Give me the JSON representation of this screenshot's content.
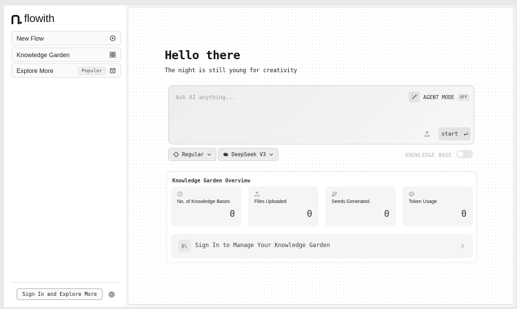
{
  "app": {
    "name": "flowith"
  },
  "sidebar": {
    "items": [
      {
        "label": "New Flow",
        "icon": "chat-plus-icon"
      },
      {
        "label": "Knowledge Garden",
        "icon": "grid-icon"
      },
      {
        "label": "Explore More",
        "badge": "Popular",
        "icon": "store-icon"
      }
    ],
    "signin_label": "Sign In and Explore More",
    "settings_icon": "gear-icon"
  },
  "main": {
    "greeting": "Hello there",
    "tagline": "The night is still young for creativity",
    "prompt": {
      "placeholder": "Ask AI anything...",
      "agent_mode_label": "AGENT MODE",
      "agent_mode_state": "OFF",
      "start_label": "start"
    },
    "mode_chip": "Regular",
    "model_chip": "DeepSeek V3",
    "knowledge_base_label": "KNOWLEDGE BASE",
    "knowledge_base_enabled": false,
    "knowledge_garden": {
      "title": "Knowledge Garden Overview",
      "stats": [
        {
          "label": "No. of Knowledge Bases",
          "value": "0",
          "icon": "clock-icon"
        },
        {
          "label": "Files Uploaded",
          "value": "0",
          "icon": "upload-icon"
        },
        {
          "label": "Seeds Generated",
          "value": "0",
          "icon": "leaf-icon"
        },
        {
          "label": "Token Usage",
          "value": "0",
          "icon": "token-icon"
        }
      ],
      "signin_cta": "Sign In to Manage Your Knowledge Garden"
    }
  },
  "colors": {
    "accent": "#111111",
    "background": "#ffffff",
    "muted": "#9a9a9a"
  }
}
